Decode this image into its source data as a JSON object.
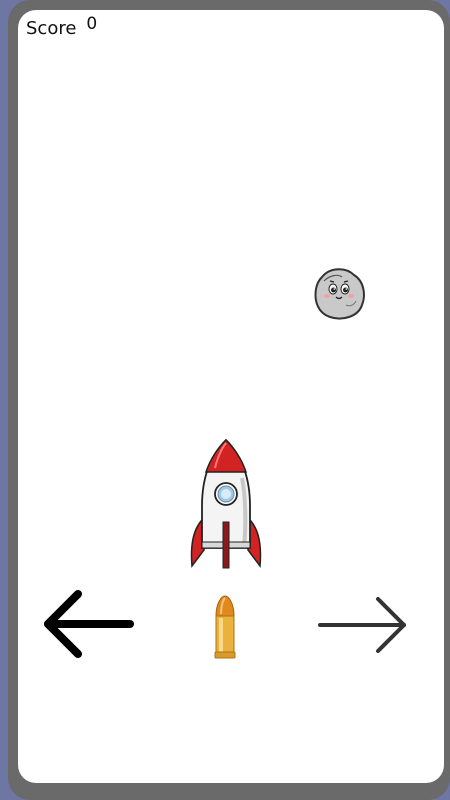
{
  "hud": {
    "score_label": "Score",
    "score_value": "0"
  },
  "sprites": {
    "asteroid_icon": "smiling-asteroid",
    "rocket_icon": "rocket",
    "bullet_icon": "bullet"
  },
  "controls": {
    "left_icon": "arrow-left",
    "right_icon": "arrow-right",
    "fire_icon": "bullet"
  },
  "colors": {
    "background": "#6e77a4",
    "bezel": "#6a6a6a",
    "screen": "#ffffff",
    "rocket_red": "#d32222",
    "bullet_gold": "#e6a02a"
  }
}
